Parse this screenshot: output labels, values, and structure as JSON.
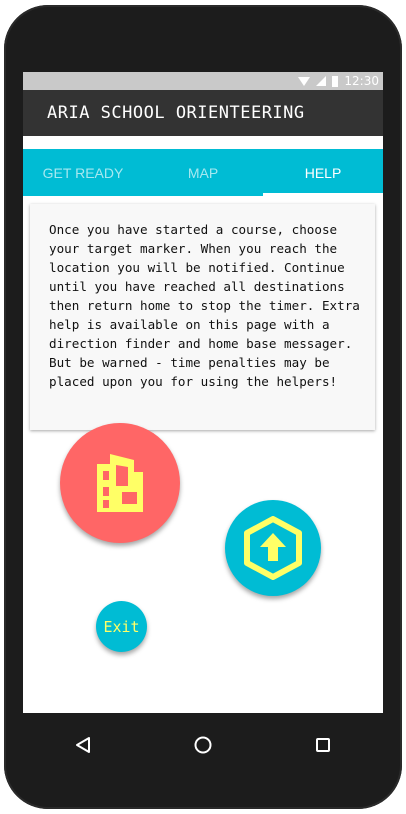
{
  "status_bar": {
    "time": "12:30",
    "icons": [
      "wifi-icon",
      "signal-icon",
      "battery-icon"
    ]
  },
  "app_bar": {
    "title": "ARIA SCHOOL ORIENTEERING"
  },
  "tabs": [
    {
      "label": "GET READY",
      "active": false
    },
    {
      "label": "MAP",
      "active": false
    },
    {
      "label": "HELP",
      "active": true
    }
  ],
  "help_card": {
    "text": "Once you have started a course, choose your target marker. When you reach the location you will be notified. Continue until you have reached all destinations then return home to stop the timer. Extra help is available on this page with a direction finder and home base messager. But be warned - time penalties may be placed upon you for using the helpers!"
  },
  "buttons": {
    "home_base": {
      "icon": "building-icon",
      "color": "#ff6666",
      "icon_color": "#ffff66"
    },
    "direction_finder": {
      "icon": "up-arrow-hexagon-icon",
      "color": "#00bcd4",
      "icon_color": "#ffff66"
    },
    "exit": {
      "label": "Exit",
      "color": "#00bcd4",
      "label_color": "#ffff66"
    }
  },
  "nav_bar": {
    "icons": [
      "back-icon",
      "home-icon",
      "recents-icon"
    ]
  },
  "colors": {
    "accent": "#00bcd4",
    "app_bar": "#333333",
    "highlight": "#ffff66"
  }
}
